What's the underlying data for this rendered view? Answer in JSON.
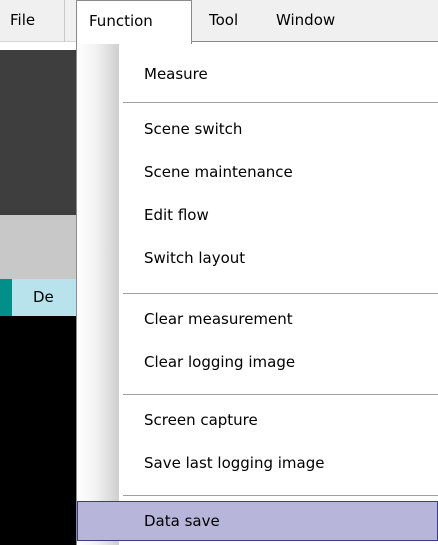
{
  "menubar": {
    "items": [
      {
        "label": "File"
      },
      {
        "label": "Function"
      },
      {
        "label": "Tool"
      },
      {
        "label": "Window"
      }
    ]
  },
  "background": {
    "tab_label": "De"
  },
  "dropdown": {
    "items": [
      {
        "label": "Measure"
      },
      {
        "label": "Scene switch"
      },
      {
        "label": "Scene maintenance"
      },
      {
        "label": "Edit flow"
      },
      {
        "label": "Switch layout"
      },
      {
        "label": "Clear measurement"
      },
      {
        "label": "Clear logging image"
      },
      {
        "label": "Screen capture"
      },
      {
        "label": "Save last logging image"
      },
      {
        "label": "Data save"
      }
    ],
    "highlighted": "Data save"
  },
  "colors": {
    "highlight_fill": "#b7b5da",
    "highlight_border": "#3c3b8a",
    "teal_accent": "#00908a",
    "tab_strip": "#b9e3ec"
  }
}
